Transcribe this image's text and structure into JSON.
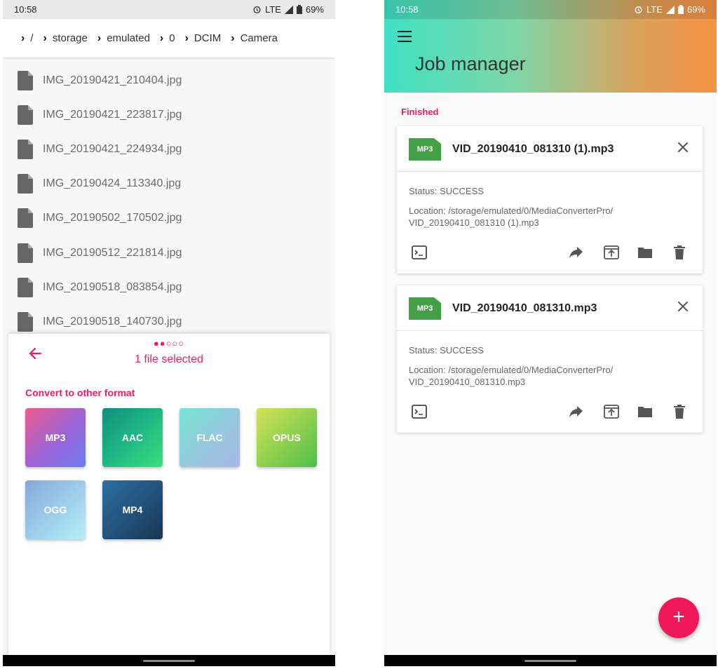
{
  "left": {
    "status": {
      "time": "10:58",
      "alarm_icon": "alarm-icon",
      "network": "LTE",
      "battery": "69%"
    },
    "breadcrumb": [
      {
        "label": "/"
      },
      {
        "label": "storage"
      },
      {
        "label": "emulated"
      },
      {
        "label": "0"
      },
      {
        "label": "DCIM"
      },
      {
        "label": "Camera"
      }
    ],
    "files": [
      "IMG_20190421_210404.jpg",
      "IMG_20190421_223817.jpg",
      "IMG_20190421_224934.jpg",
      "IMG_20190424_113340.jpg",
      "IMG_20190502_170502.jpg",
      "IMG_20190512_221814.jpg",
      "IMG_20190518_083854.jpg",
      "IMG_20190518_140730.jpg"
    ],
    "sheet": {
      "step_dots": "●●○○○",
      "selected": "1 file selected",
      "convert_label": "Convert to other format",
      "formats": [
        "MP3",
        "AAC",
        "FLAC",
        "OPUS",
        "OGG",
        "MP4"
      ]
    }
  },
  "right": {
    "status": {
      "time": "10:58",
      "network": "LTE",
      "battery": "69%"
    },
    "title": "Job manager",
    "section": "Finished",
    "jobs": [
      {
        "badge": "MP3",
        "name": "VID_20190410_081310 (1).mp3",
        "status": "Status: SUCCESS",
        "location": "Location: /storage/emulated/0/MediaConverterPro/ VID_20190410_081310 (1).mp3"
      },
      {
        "badge": "MP3",
        "name": "VID_20190410_081310.mp3",
        "status": "Status: SUCCESS",
        "location": "Location: /storage/emulated/0/MediaConverterPro/ VID_20190410_081310.mp3"
      }
    ],
    "fab": "+"
  }
}
